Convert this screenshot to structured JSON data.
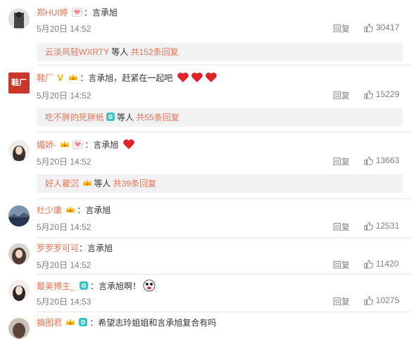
{
  "comments": [
    {
      "username": "郑HUI婷",
      "text": "言承旭",
      "date": "5月20日",
      "time": "14:52",
      "reply_label": "回复",
      "likes": "30417",
      "sub_reply": {
        "name": "云淡风轻WXRTY",
        "others": "等人",
        "total": "共152条回复"
      }
    },
    {
      "username": "鞋厂",
      "text": "言承旭，赶紧在一起吧",
      "date": "5月20日",
      "time": "14:52",
      "reply_label": "回复",
      "likes": "15229",
      "avatar_text": "鞋厂",
      "sub_reply": {
        "name": "吃不胖的死胖纸",
        "others": "等人",
        "total": "共55条回复"
      }
    },
    {
      "username": "媚娇-",
      "text": "言承旭",
      "date": "5月20日",
      "time": "14:52",
      "reply_label": "回复",
      "likes": "13663",
      "sub_reply": {
        "name": "好人瞿沉",
        "others": "等人",
        "total": "共39条回复"
      }
    },
    {
      "username": "杜少康",
      "text": "言承旭",
      "date": "5月20日",
      "time": "14:52",
      "reply_label": "回复",
      "likes": "12531"
    },
    {
      "username": "罗罗罗可可",
      "text": "言承旭",
      "date": "5月20日",
      "time": "14:52",
      "reply_label": "回复",
      "likes": "11420"
    },
    {
      "username": "最美博主_",
      "text": "言承旭啊！",
      "date": "5月20日",
      "time": "14:53",
      "reply_label": "回复",
      "likes": "10275"
    },
    {
      "username": "摘图君",
      "text": "希望志玲姐姐和言承旭复合有吗"
    }
  ],
  "colors": {
    "username": "#eb7350",
    "meta": "#808080",
    "heart": "#e0242a",
    "subbox_bg": "#f2f2f5"
  },
  "icons": [
    "thumbs-up-icon",
    "heart-emoji",
    "crown-badge",
    "vip-badge",
    "camera-badge",
    "face-emoji"
  ]
}
